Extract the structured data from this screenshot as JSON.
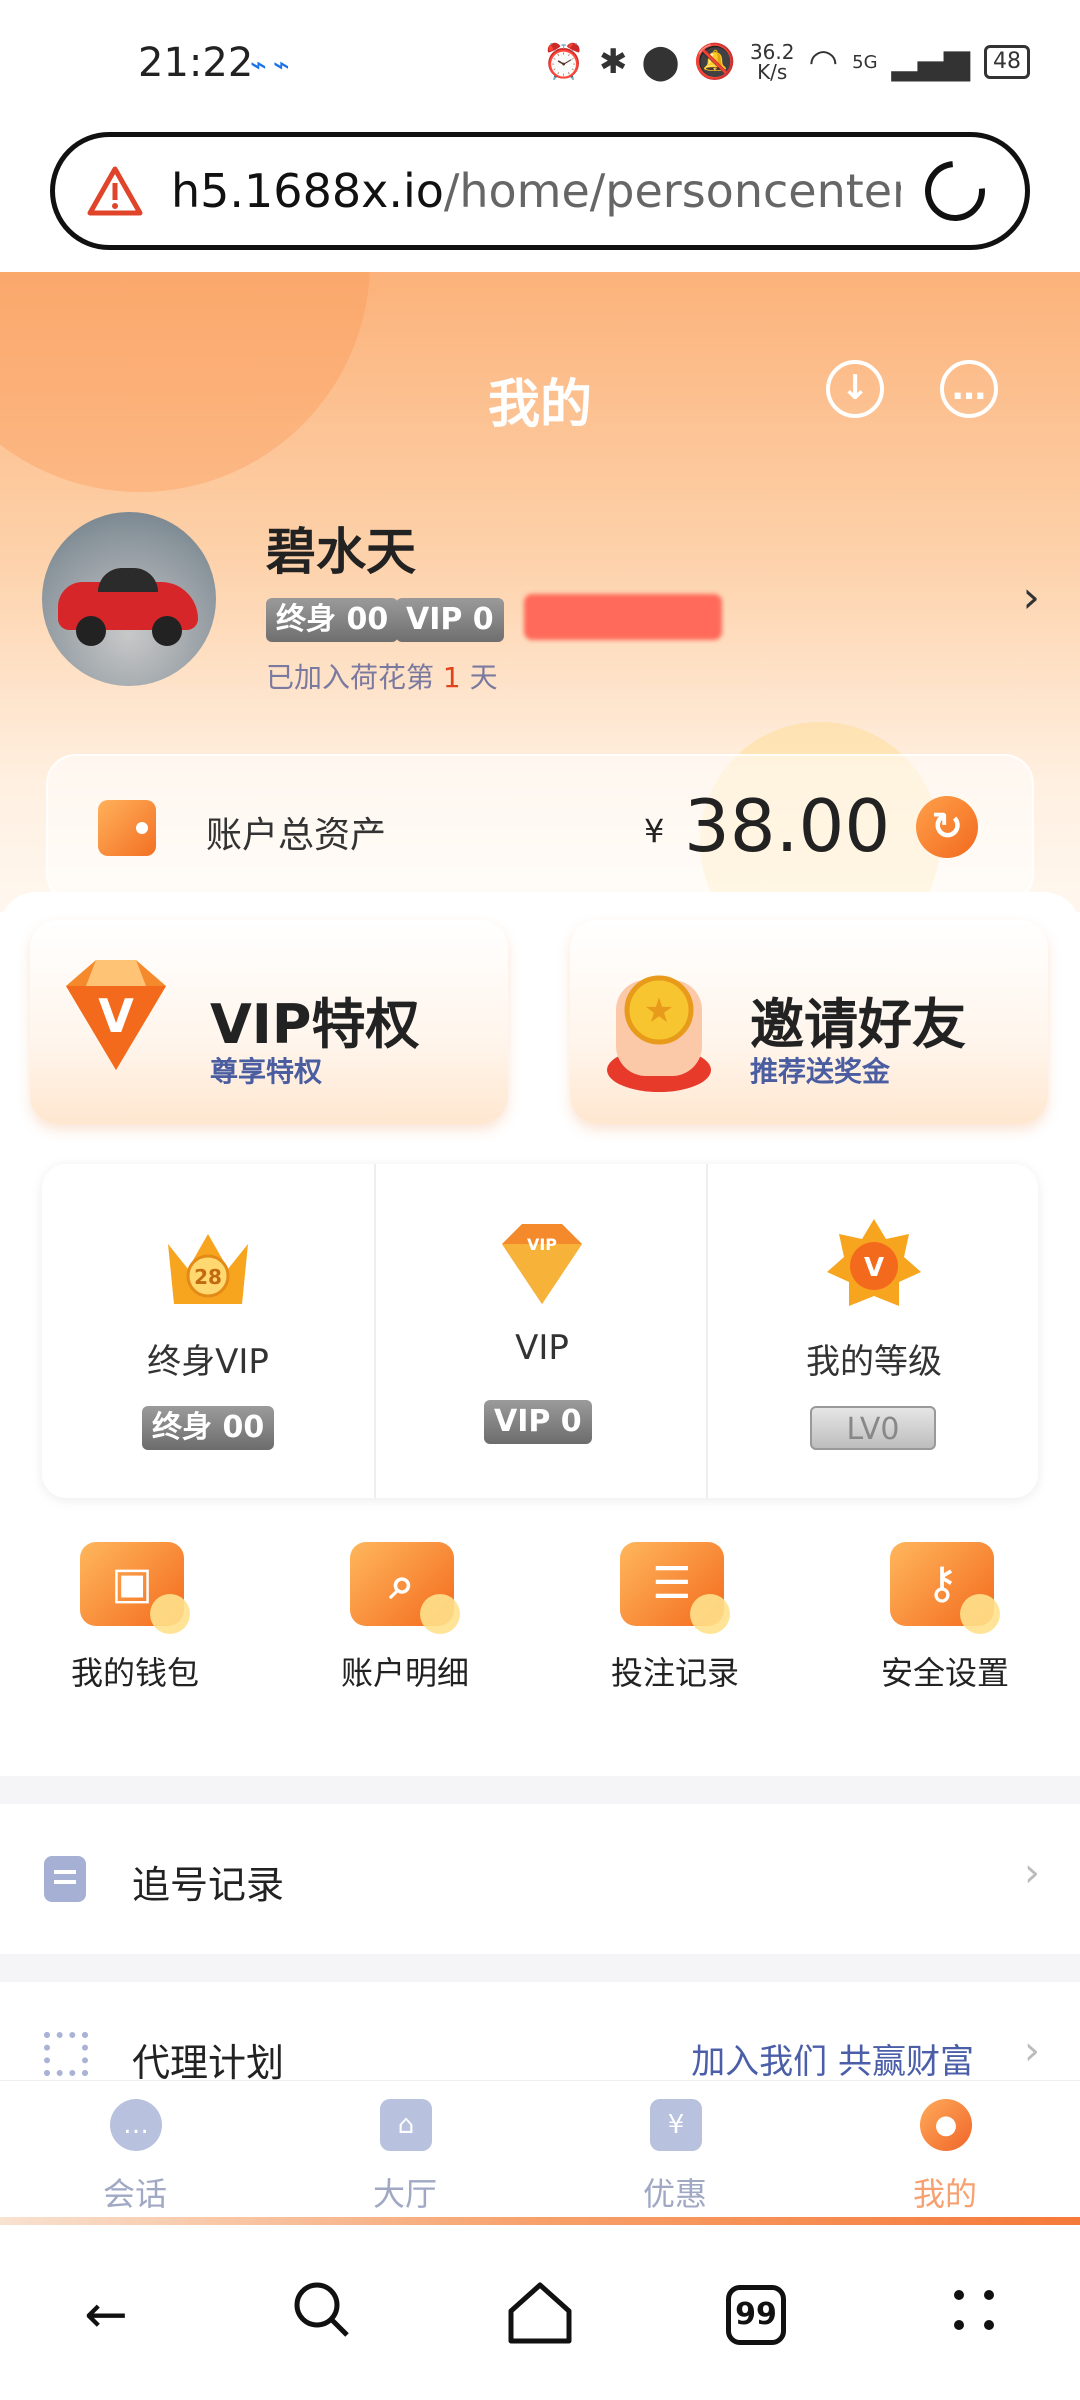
{
  "status_bar": {
    "time": "21:22",
    "net_speed_value": "36.2",
    "net_speed_unit": "K/s",
    "signal": "5G",
    "battery": "48"
  },
  "browser": {
    "url_host": "h5.1688x.io",
    "url_path": "/home/personcenter?l"
  },
  "header": {
    "title": "我的"
  },
  "profile": {
    "name": "碧水天",
    "badge_lifetime": "终身 00",
    "badge_vip": "VIP 0",
    "joined_prefix": "已加入荷花第 ",
    "joined_days": "1",
    "joined_suffix": " 天"
  },
  "assets": {
    "label": "账户总资产",
    "currency": "¥",
    "value": "38.00"
  },
  "promos": [
    {
      "title": "VIP特权",
      "subtitle": "尊享特权"
    },
    {
      "title": "邀请好友",
      "subtitle": "推荐送奖金"
    }
  ],
  "levels": [
    {
      "label": "终身VIP",
      "badge": "终身 00",
      "icon_text": "28"
    },
    {
      "label": "VIP",
      "badge": "VIP 0",
      "icon_text": "VIP"
    },
    {
      "label": "我的等级",
      "badge": "LV0",
      "icon_text": "V"
    }
  ],
  "quick_actions": [
    {
      "label": "我的钱包"
    },
    {
      "label": "账户明细"
    },
    {
      "label": "投注记录"
    },
    {
      "label": "安全设置"
    }
  ],
  "menu_rows": [
    {
      "label": "追号记录",
      "extra": ""
    },
    {
      "label": "代理计划",
      "extra": "加入我们 共赢财富"
    }
  ],
  "tabbar": [
    {
      "label": "会话",
      "active": false
    },
    {
      "label": "大厅",
      "active": false
    },
    {
      "label": "优惠",
      "active": false
    },
    {
      "label": "我的",
      "active": true
    }
  ],
  "system_nav": {
    "tabs_count": "99"
  },
  "colors": {
    "accent": "#f36a1d",
    "header_top": "#fcb27a",
    "tab_active": "#f7a070",
    "tab_inactive": "#a0a8c4"
  }
}
